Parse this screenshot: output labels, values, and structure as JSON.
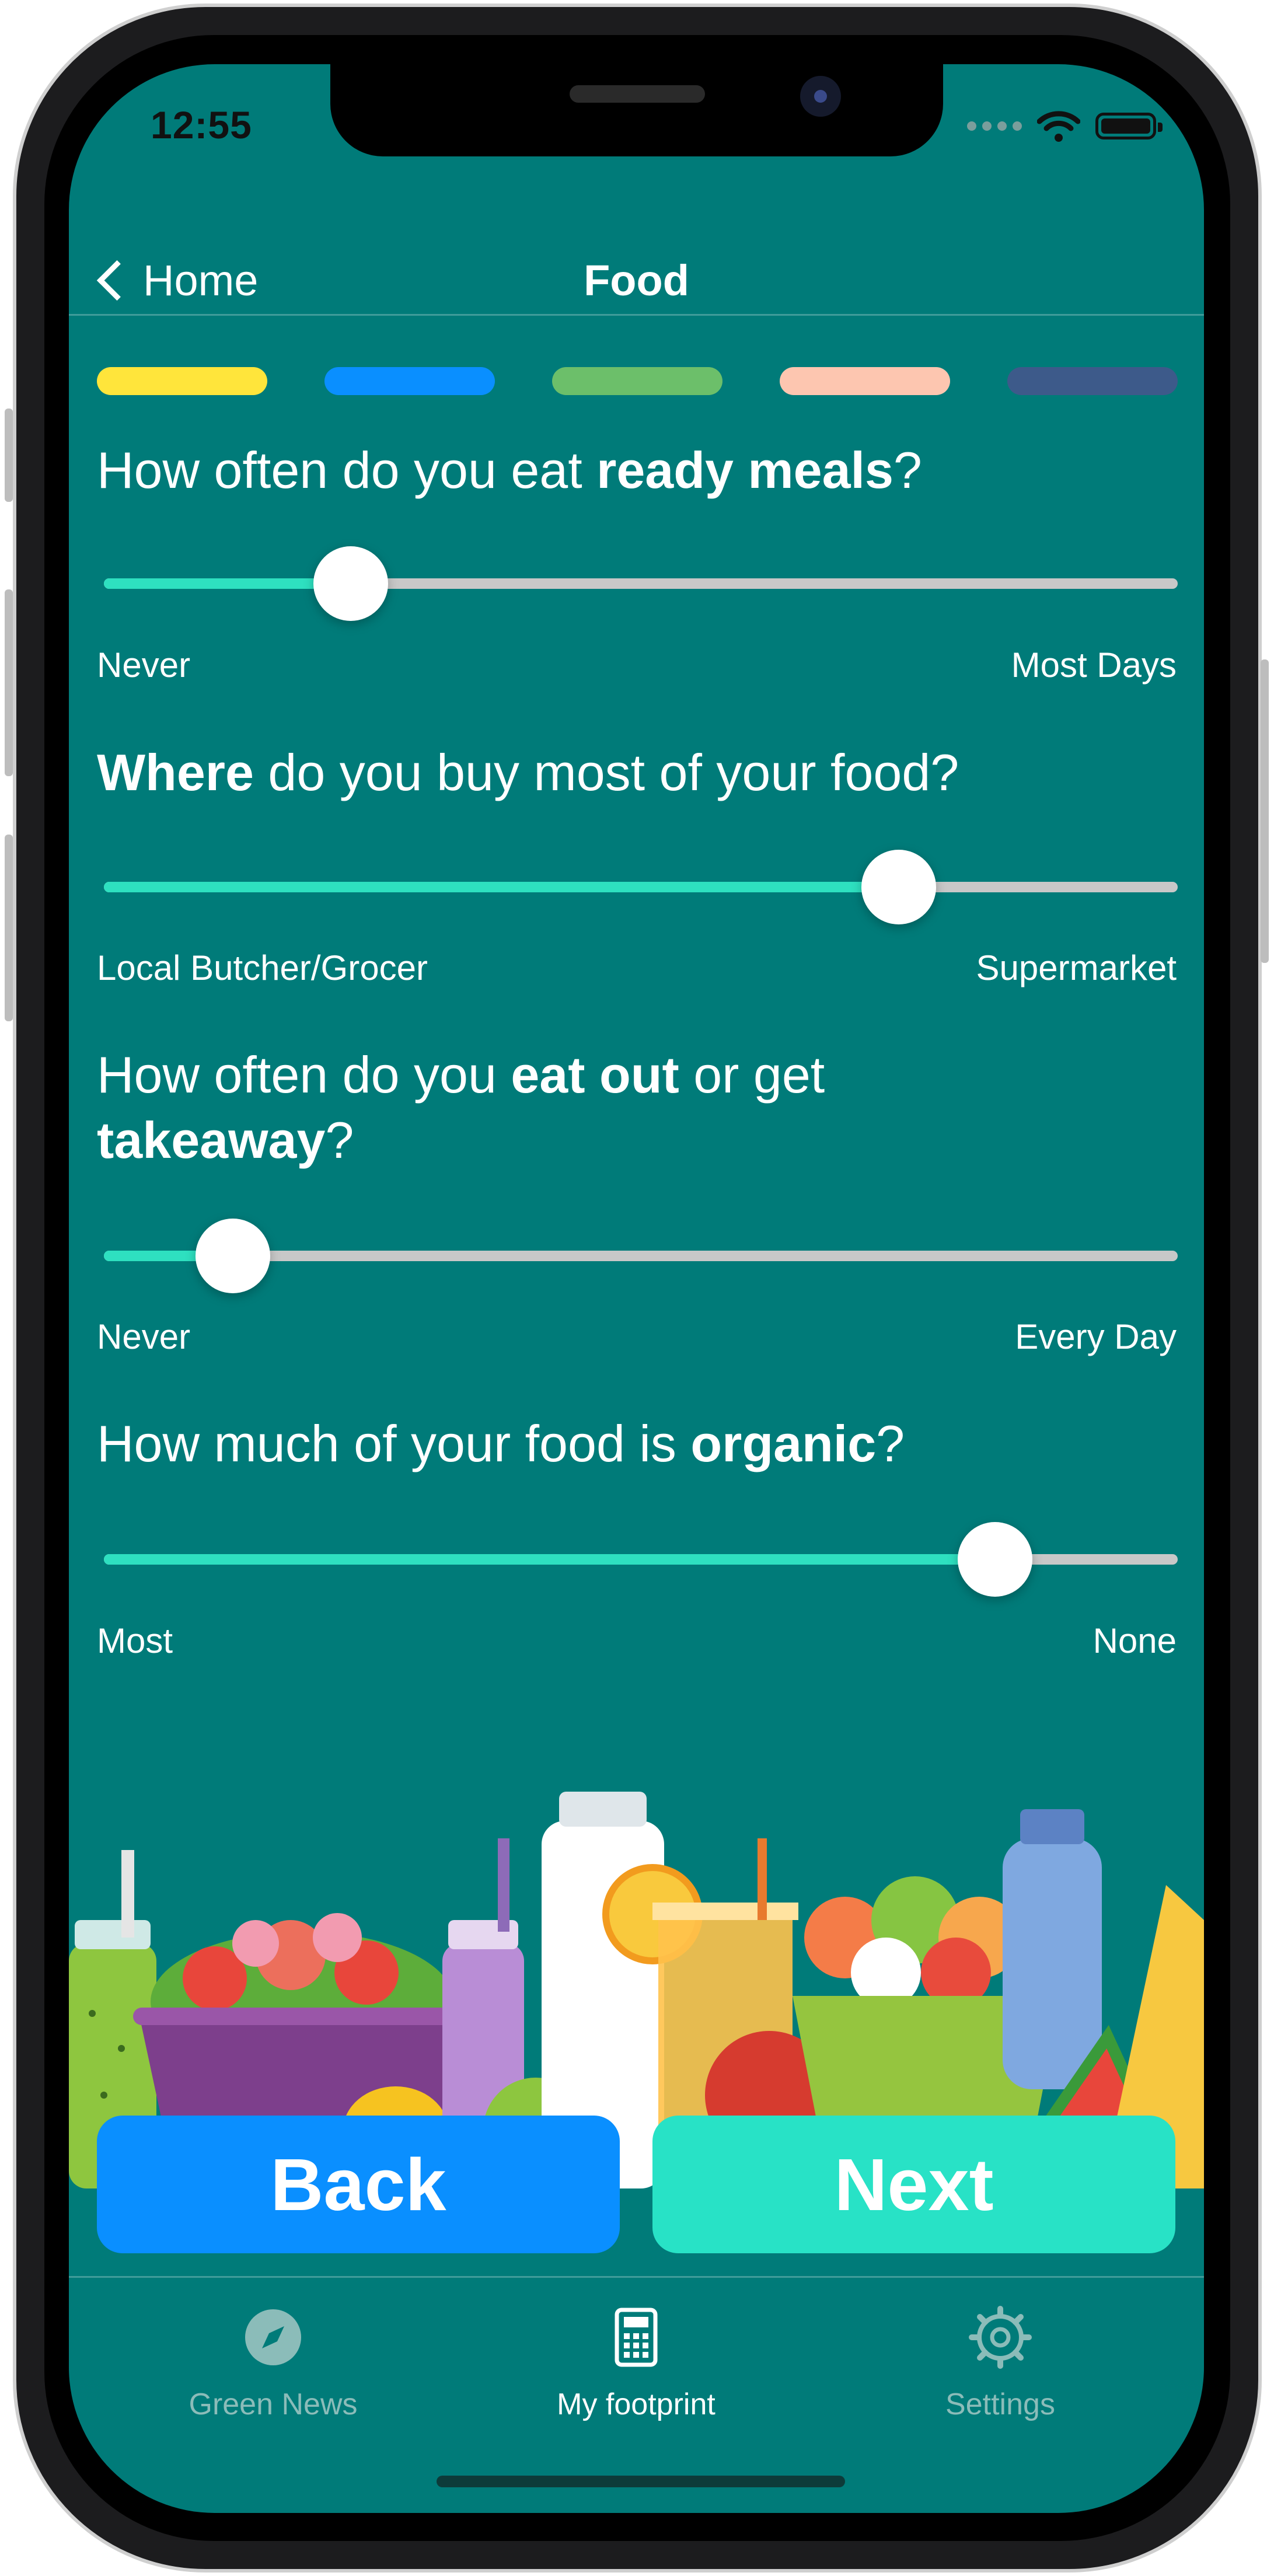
{
  "status_bar": {
    "time": "12:55",
    "icons": [
      "signal-dots-icon",
      "wifi-icon",
      "battery-icon"
    ]
  },
  "nav": {
    "back_label": "Home",
    "title": "Food"
  },
  "progress_steps": [
    {
      "color": "#ffe53b",
      "state": "current"
    },
    {
      "color": "#0a8fff",
      "state": "upcoming"
    },
    {
      "color": "#6cbf6a",
      "state": "upcoming"
    },
    {
      "color": "#fdc6b0",
      "state": "upcoming"
    },
    {
      "color": "#3d5a8a",
      "state": "upcoming"
    }
  ],
  "questions": [
    {
      "prefix": "How often do you eat ",
      "bold": "ready meals",
      "suffix": "?",
      "min_label": "Never",
      "max_label": "Most Days",
      "value": 0.23
    },
    {
      "prefix": "",
      "bold": "Where",
      "suffix": " do you buy most of your food?",
      "min_label": "Local Butcher/Grocer",
      "max_label": "Supermarket",
      "value": 0.74
    },
    {
      "prefix": "How often do you ",
      "bold": "eat out",
      "suffix": " or get",
      "bold2": "takeaway",
      "suffix2": "?",
      "min_label": "Never",
      "max_label": "Every Day",
      "value": 0.12
    },
    {
      "prefix": "How much of your food is ",
      "bold": "organic",
      "suffix": "?",
      "min_label": "Most",
      "max_label": "None",
      "value": 0.83
    }
  ],
  "buttons": {
    "back": "Back",
    "next": "Next"
  },
  "tab_bar": [
    {
      "label": "Green News",
      "icon": "compass-icon",
      "active": false
    },
    {
      "label": "My footprint",
      "icon": "calculator-icon",
      "active": true
    },
    {
      "label": "Settings",
      "icon": "gear-icon",
      "active": false
    }
  ],
  "colors": {
    "background": "#007b79",
    "slider_fill": "#2ee0c0",
    "slider_track": "#c8c8c8",
    "back_button": "#0a8fff",
    "next_button": "#28e2c6"
  }
}
